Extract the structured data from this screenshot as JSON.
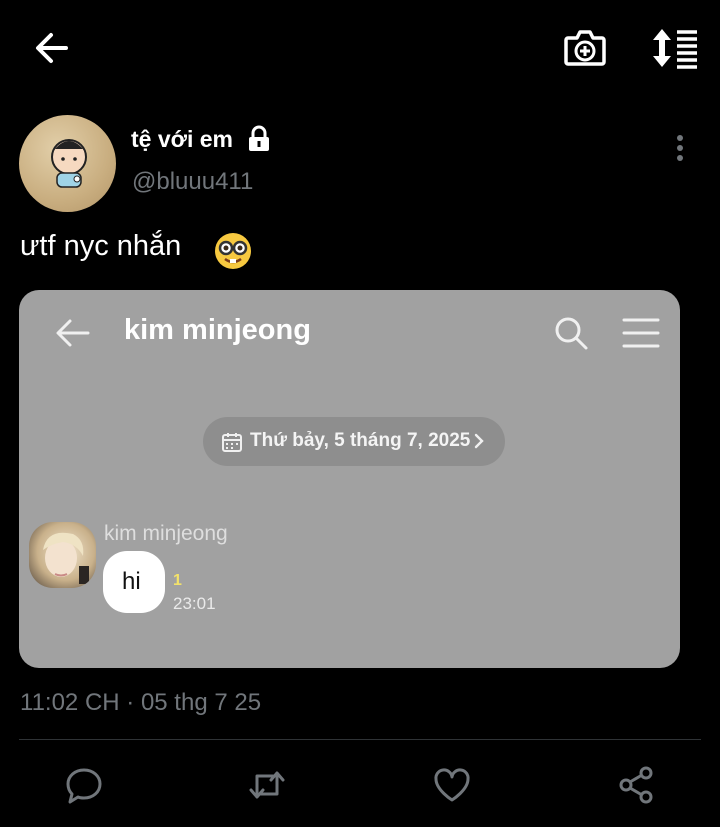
{
  "author": {
    "display_name": "tệ với em",
    "handle": "@bluuu411"
  },
  "tweet": {
    "text": "ưtf nyc nhắn",
    "timestamp": "11:02 CH · 05 thg 7 25"
  },
  "media": {
    "chat_title": "kim minjeong",
    "date_pill": "Thứ bảy, 5 tháng 7, 2025",
    "sender_name": "kim minjeong",
    "message": "hi",
    "unread_count": "1",
    "message_time": "23:01"
  },
  "icons": {
    "back": "arrow-left-icon",
    "camera": "camera-plus-icon",
    "sort": "sort-list-icon",
    "lock": "lock-icon",
    "more": "more-vertical-icon",
    "reply": "reply-icon",
    "retweet": "retweet-icon",
    "like": "heart-icon",
    "share": "share-icon"
  },
  "colors": {
    "background": "#000000",
    "muted_text": "#71767b",
    "media_background": "#a1a1a1"
  }
}
